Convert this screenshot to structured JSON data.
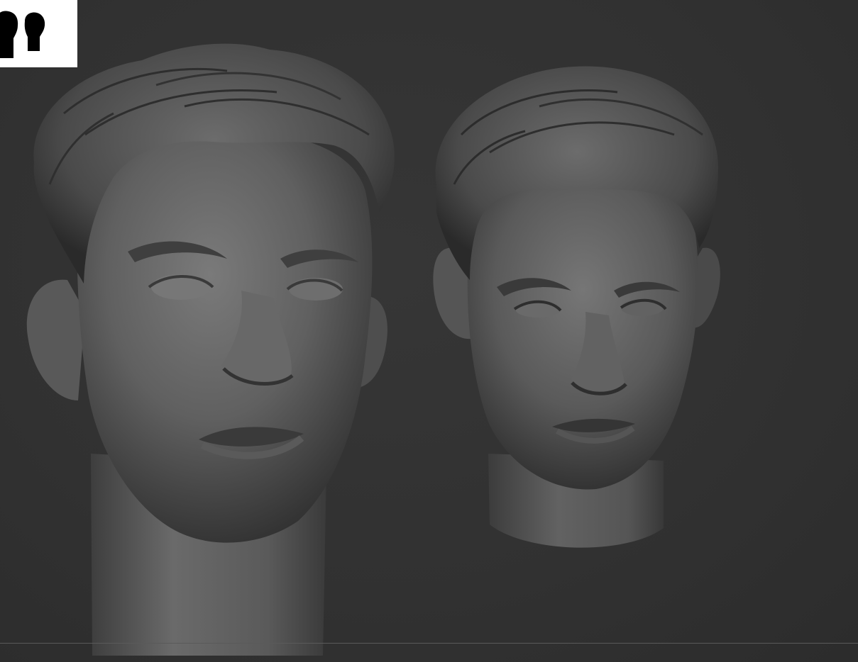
{
  "app": {
    "name": "",
    "background_color": "#323232",
    "navigator_background": "#ffffff"
  },
  "scene": {
    "subtools": [
      {
        "name": "",
        "kind": "head-sculpt-bust-front",
        "material_color": "#6e6e6e"
      },
      {
        "name": "",
        "kind": "head-sculpt-bust-angled",
        "material_color": "#6e6e6e"
      }
    ],
    "navigator": {
      "icons": [
        "head-silhouette-icon",
        "head-silhouette-icon"
      ],
      "silhouette_color": "#000000"
    }
  }
}
